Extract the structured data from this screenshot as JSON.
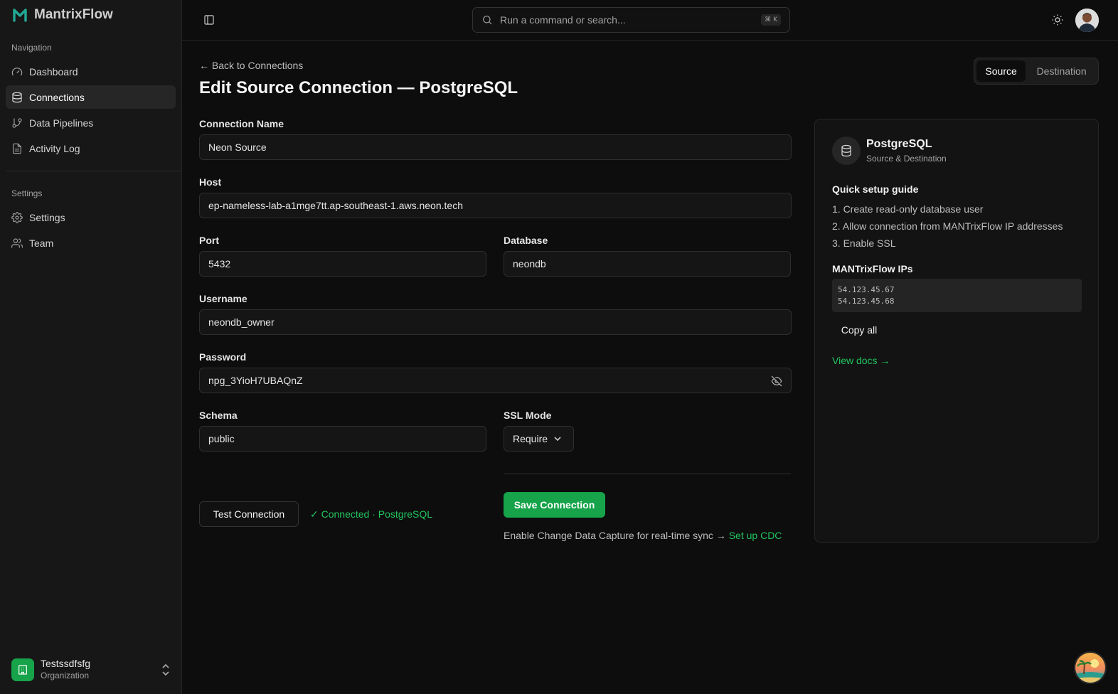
{
  "app": {
    "brand": "MantrixFlow"
  },
  "sidebar": {
    "navigation_label": "Navigation",
    "settings_label": "Settings",
    "nav_items": [
      {
        "label": "Dashboard",
        "icon": "gauge-icon"
      },
      {
        "label": "Connections",
        "icon": "database-icon",
        "active": true
      },
      {
        "label": "Data Pipelines",
        "icon": "git-branch-icon"
      },
      {
        "label": "Activity Log",
        "icon": "file-text-icon"
      }
    ],
    "settings_items": [
      {
        "label": "Settings",
        "icon": "gear-icon"
      },
      {
        "label": "Team",
        "icon": "users-icon"
      }
    ],
    "org": {
      "name": "Testssdfsfg",
      "type": "Organization"
    }
  },
  "header": {
    "search_placeholder": "Run a command or search...",
    "shortcut": "⌘ K"
  },
  "main": {
    "back_link": "← Back to Connections",
    "title": "Edit Source Connection — PostgreSQL",
    "tabs": [
      "Source",
      "Destination"
    ],
    "active_tab": "Source",
    "form": {
      "connection_name": {
        "label": "Connection Name",
        "value": "Neon Source"
      },
      "host": {
        "label": "Host",
        "value": "ep-nameless-lab-a1mge7tt.ap-southeast-1.aws.neon.tech"
      },
      "port": {
        "label": "Port",
        "value": "5432"
      },
      "database": {
        "label": "Database",
        "value": "neondb"
      },
      "username": {
        "label": "Username",
        "value": "neondb_owner"
      },
      "password": {
        "label": "Password",
        "value": "npg_3YioH7UBAQnZ"
      },
      "schema": {
        "label": "Schema",
        "value": "public"
      },
      "ssl_mode": {
        "label": "SSL Mode",
        "value": "Require"
      }
    },
    "test_button": "Test Connection",
    "test_status": "✓ Connected · PostgreSQL",
    "save_button": "Save Connection",
    "cdc_text": "Enable Change Data Capture for real-time sync →",
    "cdc_link": "Set up CDC"
  },
  "panel": {
    "title": "PostgreSQL",
    "subtitle": "Source & Destination",
    "guide_title": "Quick setup guide",
    "guide_steps": [
      "1. Create read-only database user",
      "2. Allow connection from MANTrixFlow IP addresses",
      "3. Enable SSL"
    ],
    "ips_title": "MANTrixFlow IPs",
    "ips": [
      "54.123.45.67",
      "54.123.45.68"
    ],
    "copy_button": "Copy all",
    "docs_link": "View docs →"
  },
  "colors": {
    "accent": "#16a34a",
    "accent_text": "#22c55e",
    "background": "#0d0d0d",
    "sidebar": "#171717"
  }
}
